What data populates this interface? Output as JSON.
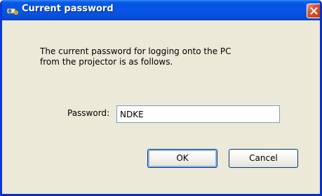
{
  "window": {
    "title": "Current password",
    "icon": "projector-network-icon",
    "close_icon": "close-icon"
  },
  "message": {
    "line1": "The current password for logging onto the PC",
    "line2": "from the projector is as follows."
  },
  "password": {
    "label": "Password:",
    "value": "NDKE"
  },
  "buttons": {
    "ok": "OK",
    "cancel": "Cancel"
  },
  "colors": {
    "titlebar": "#0655e6",
    "dialog_bg": "#ece9d8",
    "close_button": "#d9502b"
  }
}
